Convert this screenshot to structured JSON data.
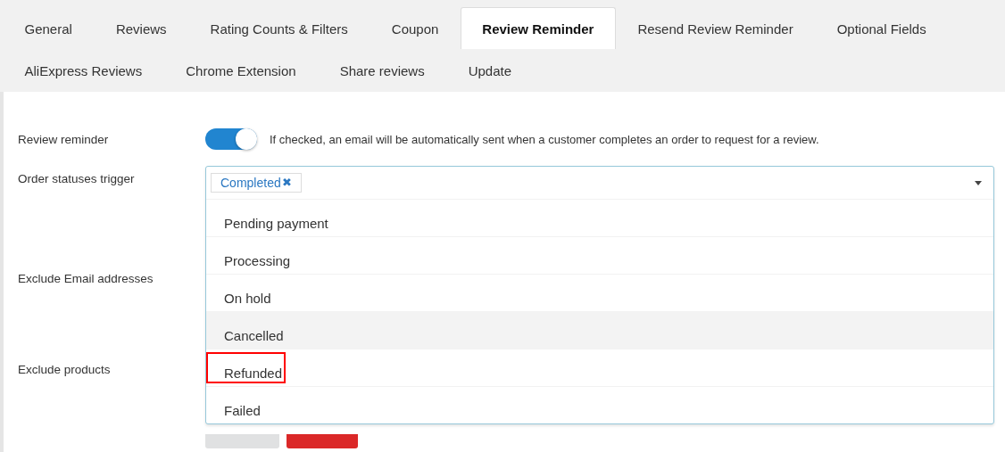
{
  "tabs": [
    {
      "label": "General",
      "selected": false
    },
    {
      "label": "Reviews",
      "selected": false
    },
    {
      "label": "Rating Counts & Filters",
      "selected": false
    },
    {
      "label": "Coupon",
      "selected": false
    },
    {
      "label": "Review Reminder",
      "selected": true
    },
    {
      "label": "Resend Review Reminder",
      "selected": false
    },
    {
      "label": "Optional Fields",
      "selected": false
    },
    {
      "label": "AliExpress Reviews",
      "selected": false
    },
    {
      "label": "Chrome Extension",
      "selected": false
    },
    {
      "label": "Share reviews",
      "selected": false
    },
    {
      "label": "Update",
      "selected": false
    }
  ],
  "review_reminder": {
    "label": "Review reminder",
    "on": true,
    "description": "If checked, an email will be automatically sent when a customer completes an order to request for a review."
  },
  "order_statuses_trigger": {
    "label": "Order statuses trigger",
    "tags": [
      "Completed"
    ],
    "remove_glyph": "✖",
    "expanded": true,
    "options": [
      {
        "label": "Pending payment",
        "hovered": false,
        "highlighted": false
      },
      {
        "label": "Processing",
        "hovered": false,
        "highlighted": false
      },
      {
        "label": "On hold",
        "hovered": false,
        "highlighted": false
      },
      {
        "label": "Cancelled",
        "hovered": true,
        "highlighted": false
      },
      {
        "label": "Refunded",
        "hovered": false,
        "highlighted": true
      },
      {
        "label": "Failed",
        "hovered": false,
        "highlighted": false
      }
    ]
  },
  "exclude_email_addresses": {
    "label": "Exclude Email addresses"
  },
  "exclude_products": {
    "label": "Exclude products"
  },
  "buttons": [
    {
      "kind": "plain"
    },
    {
      "kind": "danger"
    }
  ]
}
